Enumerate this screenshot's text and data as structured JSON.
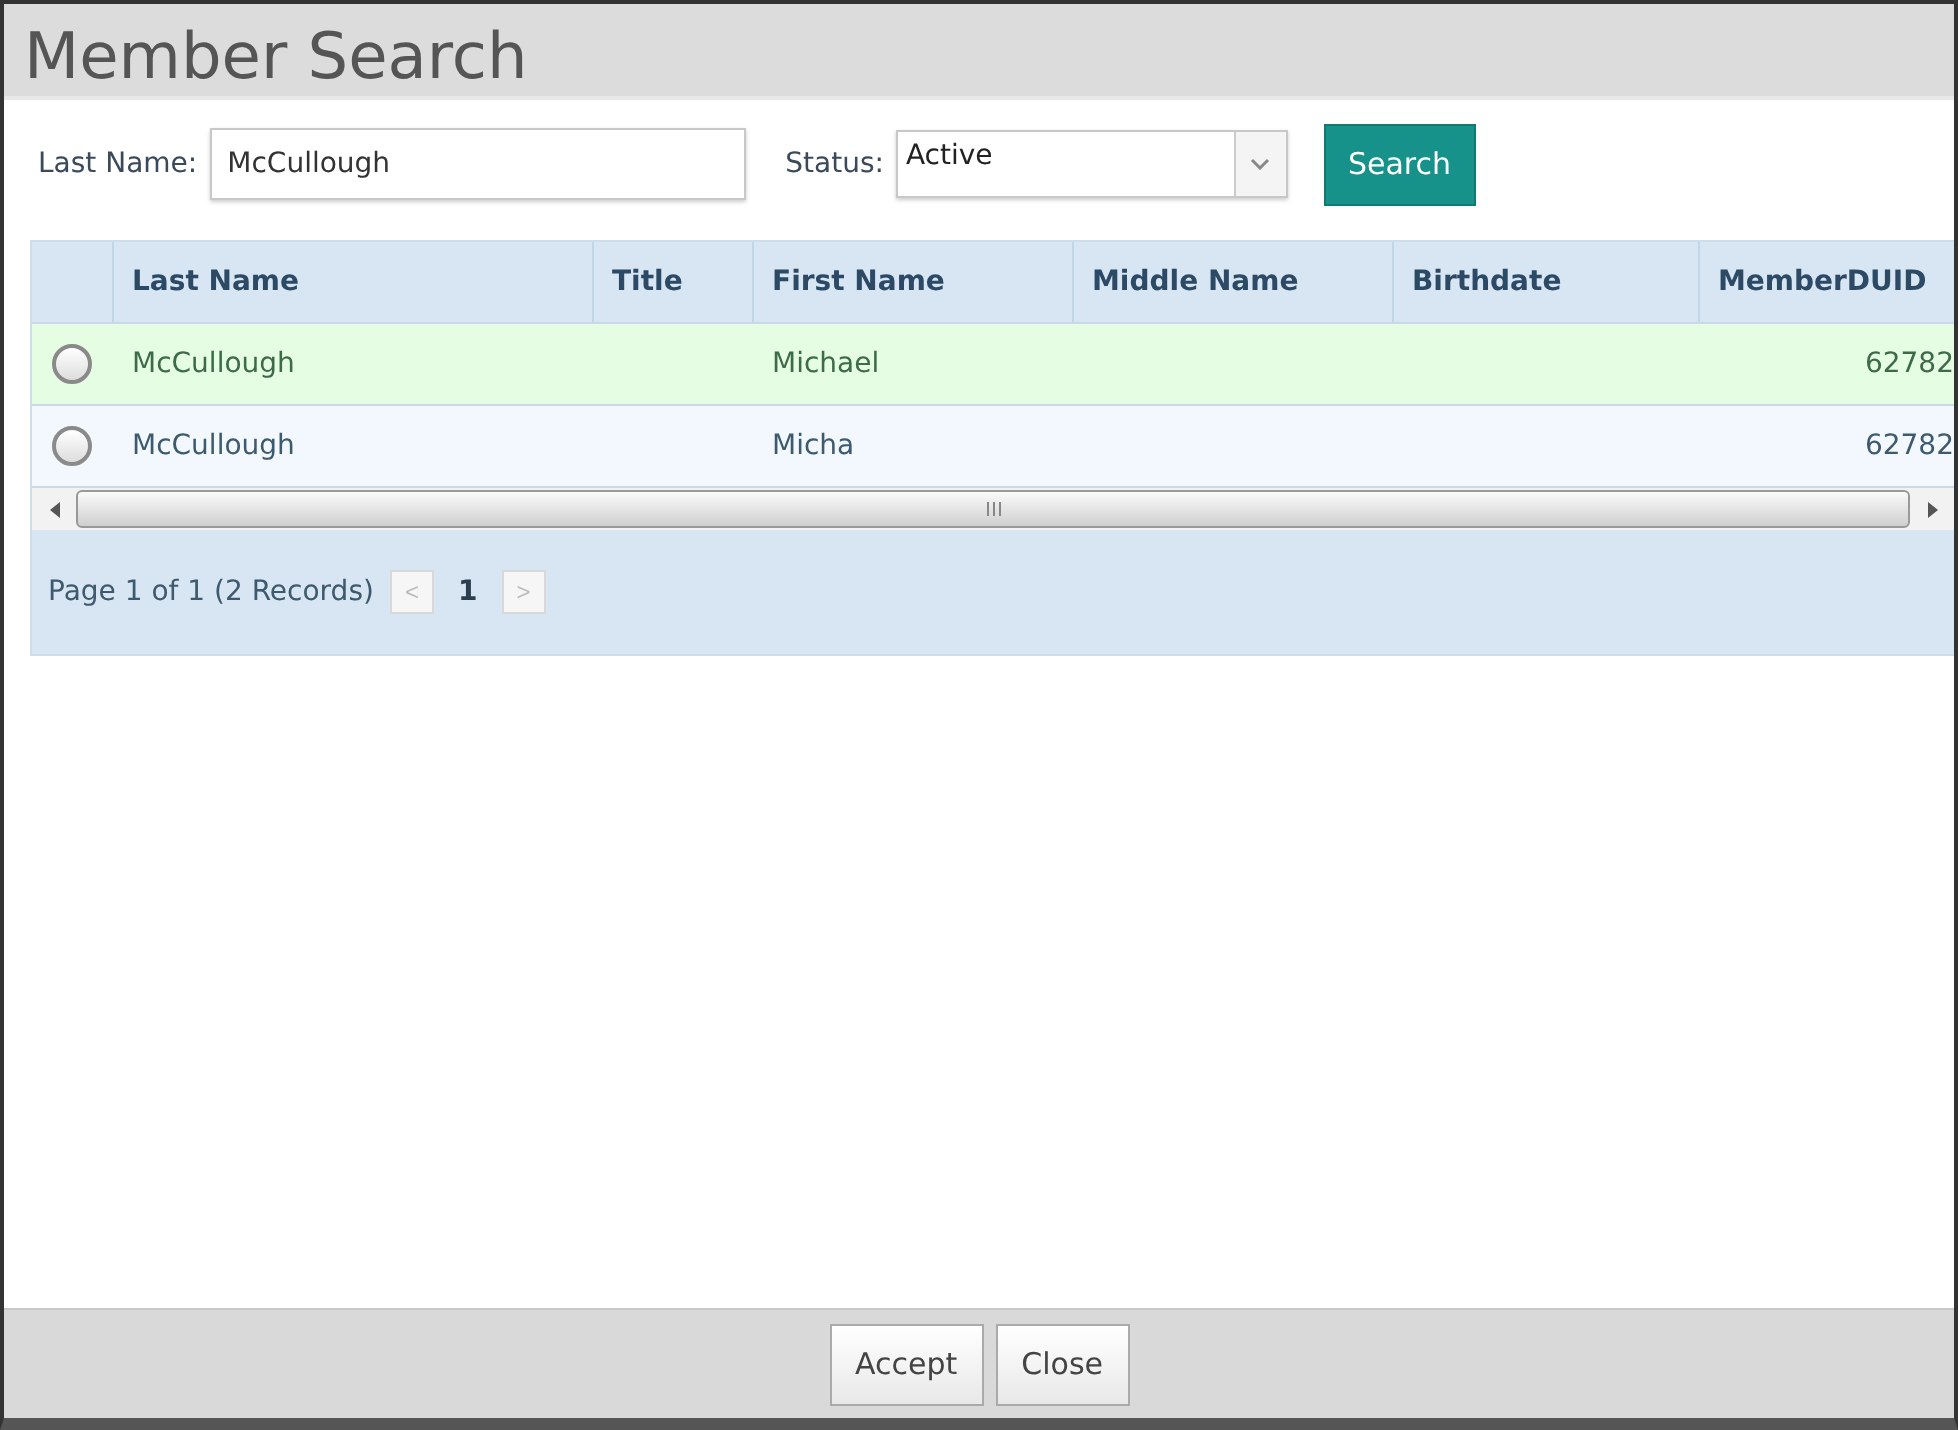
{
  "window": {
    "title": "Member Search"
  },
  "filters": {
    "last_name": {
      "label": "Last Name:",
      "value": "McCullough"
    },
    "status": {
      "label": "Status:",
      "value": "Active"
    },
    "search_button": "Search"
  },
  "table": {
    "columns": [
      "Last Name",
      "Title",
      "First Name",
      "Middle Name",
      "Birthdate",
      "MemberDUID"
    ],
    "rows": [
      {
        "checked": false,
        "highlighted": true,
        "cells": [
          "McCullough",
          "",
          "Michael",
          "",
          "",
          "62782"
        ]
      },
      {
        "checked": false,
        "highlighted": false,
        "cells": [
          "McCullough",
          "",
          "Micha",
          "",
          "",
          "62782"
        ]
      }
    ]
  },
  "pager": {
    "summary": "Page 1 of 1 (2 Records)",
    "prev": "<",
    "page": "1",
    "next": ">"
  },
  "buttons": [
    "Accept",
    "Close"
  ]
}
